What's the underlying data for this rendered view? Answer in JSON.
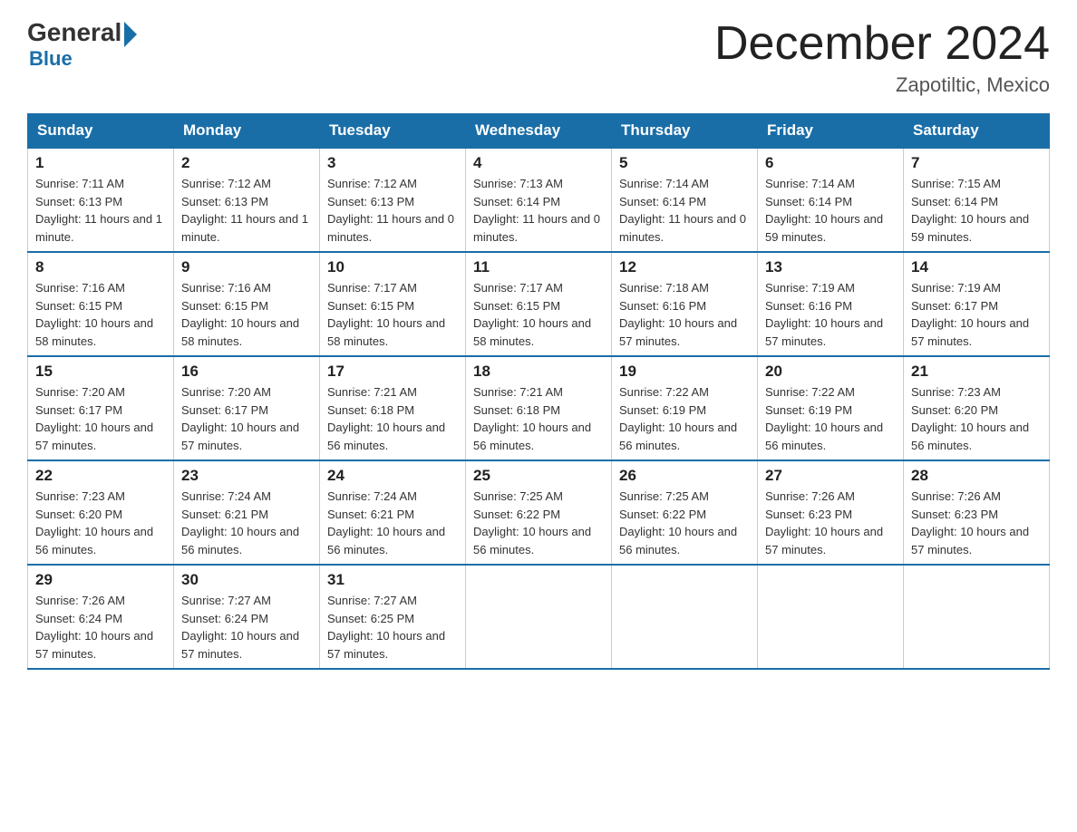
{
  "header": {
    "logo": {
      "text_general": "General",
      "text_blue": "Blue"
    },
    "title": "December 2024",
    "location": "Zapotiltic, Mexico"
  },
  "calendar": {
    "days_of_week": [
      "Sunday",
      "Monday",
      "Tuesday",
      "Wednesday",
      "Thursday",
      "Friday",
      "Saturday"
    ],
    "weeks": [
      [
        {
          "day": "1",
          "sunrise": "7:11 AM",
          "sunset": "6:13 PM",
          "daylight": "11 hours and 1 minute."
        },
        {
          "day": "2",
          "sunrise": "7:12 AM",
          "sunset": "6:13 PM",
          "daylight": "11 hours and 1 minute."
        },
        {
          "day": "3",
          "sunrise": "7:12 AM",
          "sunset": "6:13 PM",
          "daylight": "11 hours and 0 minutes."
        },
        {
          "day": "4",
          "sunrise": "7:13 AM",
          "sunset": "6:14 PM",
          "daylight": "11 hours and 0 minutes."
        },
        {
          "day": "5",
          "sunrise": "7:14 AM",
          "sunset": "6:14 PM",
          "daylight": "11 hours and 0 minutes."
        },
        {
          "day": "6",
          "sunrise": "7:14 AM",
          "sunset": "6:14 PM",
          "daylight": "10 hours and 59 minutes."
        },
        {
          "day": "7",
          "sunrise": "7:15 AM",
          "sunset": "6:14 PM",
          "daylight": "10 hours and 59 minutes."
        }
      ],
      [
        {
          "day": "8",
          "sunrise": "7:16 AM",
          "sunset": "6:15 PM",
          "daylight": "10 hours and 58 minutes."
        },
        {
          "day": "9",
          "sunrise": "7:16 AM",
          "sunset": "6:15 PM",
          "daylight": "10 hours and 58 minutes."
        },
        {
          "day": "10",
          "sunrise": "7:17 AM",
          "sunset": "6:15 PM",
          "daylight": "10 hours and 58 minutes."
        },
        {
          "day": "11",
          "sunrise": "7:17 AM",
          "sunset": "6:15 PM",
          "daylight": "10 hours and 58 minutes."
        },
        {
          "day": "12",
          "sunrise": "7:18 AM",
          "sunset": "6:16 PM",
          "daylight": "10 hours and 57 minutes."
        },
        {
          "day": "13",
          "sunrise": "7:19 AM",
          "sunset": "6:16 PM",
          "daylight": "10 hours and 57 minutes."
        },
        {
          "day": "14",
          "sunrise": "7:19 AM",
          "sunset": "6:17 PM",
          "daylight": "10 hours and 57 minutes."
        }
      ],
      [
        {
          "day": "15",
          "sunrise": "7:20 AM",
          "sunset": "6:17 PM",
          "daylight": "10 hours and 57 minutes."
        },
        {
          "day": "16",
          "sunrise": "7:20 AM",
          "sunset": "6:17 PM",
          "daylight": "10 hours and 57 minutes."
        },
        {
          "day": "17",
          "sunrise": "7:21 AM",
          "sunset": "6:18 PM",
          "daylight": "10 hours and 56 minutes."
        },
        {
          "day": "18",
          "sunrise": "7:21 AM",
          "sunset": "6:18 PM",
          "daylight": "10 hours and 56 minutes."
        },
        {
          "day": "19",
          "sunrise": "7:22 AM",
          "sunset": "6:19 PM",
          "daylight": "10 hours and 56 minutes."
        },
        {
          "day": "20",
          "sunrise": "7:22 AM",
          "sunset": "6:19 PM",
          "daylight": "10 hours and 56 minutes."
        },
        {
          "day": "21",
          "sunrise": "7:23 AM",
          "sunset": "6:20 PM",
          "daylight": "10 hours and 56 minutes."
        }
      ],
      [
        {
          "day": "22",
          "sunrise": "7:23 AM",
          "sunset": "6:20 PM",
          "daylight": "10 hours and 56 minutes."
        },
        {
          "day": "23",
          "sunrise": "7:24 AM",
          "sunset": "6:21 PM",
          "daylight": "10 hours and 56 minutes."
        },
        {
          "day": "24",
          "sunrise": "7:24 AM",
          "sunset": "6:21 PM",
          "daylight": "10 hours and 56 minutes."
        },
        {
          "day": "25",
          "sunrise": "7:25 AM",
          "sunset": "6:22 PM",
          "daylight": "10 hours and 56 minutes."
        },
        {
          "day": "26",
          "sunrise": "7:25 AM",
          "sunset": "6:22 PM",
          "daylight": "10 hours and 56 minutes."
        },
        {
          "day": "27",
          "sunrise": "7:26 AM",
          "sunset": "6:23 PM",
          "daylight": "10 hours and 57 minutes."
        },
        {
          "day": "28",
          "sunrise": "7:26 AM",
          "sunset": "6:23 PM",
          "daylight": "10 hours and 57 minutes."
        }
      ],
      [
        {
          "day": "29",
          "sunrise": "7:26 AM",
          "sunset": "6:24 PM",
          "daylight": "10 hours and 57 minutes."
        },
        {
          "day": "30",
          "sunrise": "7:27 AM",
          "sunset": "6:24 PM",
          "daylight": "10 hours and 57 minutes."
        },
        {
          "day": "31",
          "sunrise": "7:27 AM",
          "sunset": "6:25 PM",
          "daylight": "10 hours and 57 minutes."
        },
        null,
        null,
        null,
        null
      ]
    ]
  }
}
